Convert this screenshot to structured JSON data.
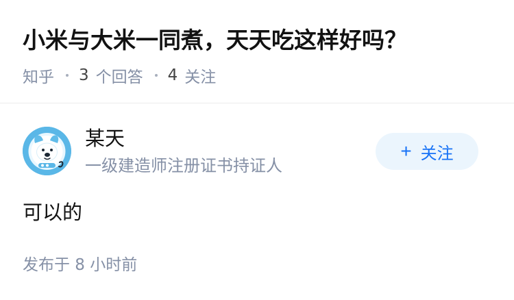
{
  "question": {
    "title": "小米与大米一同煮，天天吃这样好吗？",
    "source": "知乎",
    "answer_count": "3",
    "answer_label": "个回答",
    "follower_count": "4",
    "follower_label": "关注"
  },
  "answer": {
    "author": {
      "name": "某天",
      "headline": "一级建造师注册证书持证人",
      "avatar_icon": "dog-astronaut-avatar-icon"
    },
    "follow_button": {
      "icon": "plus-icon",
      "icon_glyph": "+",
      "label": "关注"
    },
    "content": "可以的",
    "published_label": "发布于 8 小时前"
  },
  "colors": {
    "title_text": "#121212",
    "secondary_text": "#8590a6",
    "accent_blue": "#1772f6",
    "follow_button_bg": "#ebf5fd",
    "avatar_blue": "#5ab7e7",
    "divider": "#ececec"
  }
}
